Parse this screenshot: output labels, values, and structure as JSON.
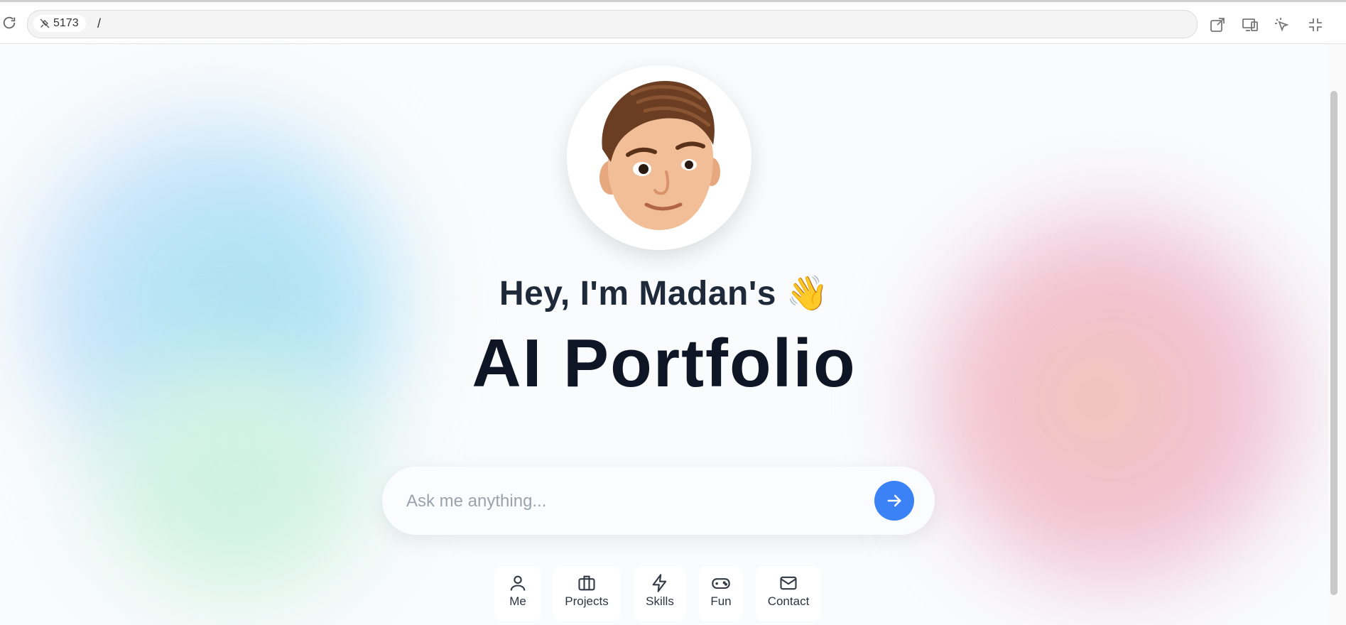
{
  "browser": {
    "port": "5173",
    "path": "/"
  },
  "hero": {
    "greeting": "Hey, I'm Madan's",
    "wave_emoji": "👋",
    "title": "AI Portfolio"
  },
  "search": {
    "placeholder": "Ask me anything..."
  },
  "nav": [
    {
      "label": "Me",
      "icon": "user-icon"
    },
    {
      "label": "Projects",
      "icon": "briefcase-icon"
    },
    {
      "label": "Skills",
      "icon": "lightning-icon"
    },
    {
      "label": "Fun",
      "icon": "gamepad-icon"
    },
    {
      "label": "Contact",
      "icon": "mail-icon"
    }
  ],
  "colors": {
    "accent": "#3b82f6",
    "heading": "#0e1626"
  }
}
